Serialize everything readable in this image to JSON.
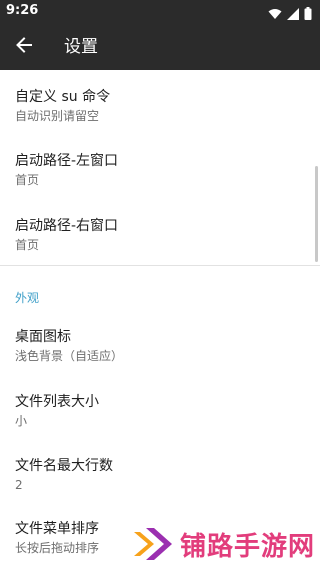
{
  "status_bar": {
    "time": "9:26"
  },
  "app_bar": {
    "title": "设置"
  },
  "prefs": [
    {
      "title": "自定义 su 命令",
      "summary": "自动识别请留空"
    },
    {
      "title": "启动路径-左窗口",
      "summary": "首页"
    },
    {
      "title": "启动路径-右窗口",
      "summary": "首页"
    }
  ],
  "category": {
    "label": "外观"
  },
  "appearance_prefs": [
    {
      "title": "桌面图标",
      "summary": "浅色背景（自适应）"
    },
    {
      "title": "文件列表大小",
      "summary": "小"
    },
    {
      "title": "文件名最大行数",
      "summary": "2"
    },
    {
      "title": "文件菜单排序",
      "summary": "长按后拖动排序"
    }
  ],
  "watermark": {
    "text": "铺路手游网"
  },
  "colors": {
    "bar": "#2b2b2b",
    "accent": "#3f9fc8",
    "watermark": "#e23d7c"
  }
}
